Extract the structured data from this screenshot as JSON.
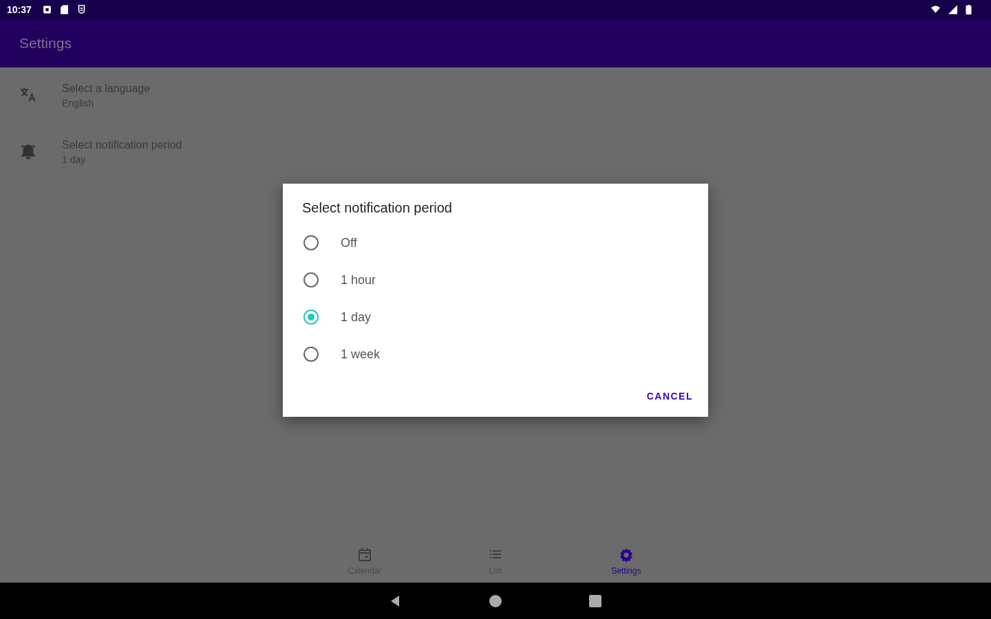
{
  "status_bar": {
    "time": "10:37"
  },
  "app_bar": {
    "title": "Settings"
  },
  "settings": [
    {
      "kind": "language",
      "title": "Select a language",
      "value": "English"
    },
    {
      "kind": "notification",
      "title": "Select notification period",
      "value": "1 day"
    }
  ],
  "dialog": {
    "title": "Select notification period",
    "options": [
      {
        "label": "Off",
        "selected": false
      },
      {
        "label": "1 hour",
        "selected": false
      },
      {
        "label": "1 day",
        "selected": true
      },
      {
        "label": "1 week",
        "selected": false
      }
    ],
    "buttons": [
      "CANCEL"
    ]
  },
  "bottom_nav": [
    {
      "kind": "calendar",
      "label": "Calendar",
      "selected": false
    },
    {
      "kind": "list",
      "label": "List",
      "selected": false
    },
    {
      "kind": "settings",
      "label": "Settings",
      "selected": true
    }
  ]
}
